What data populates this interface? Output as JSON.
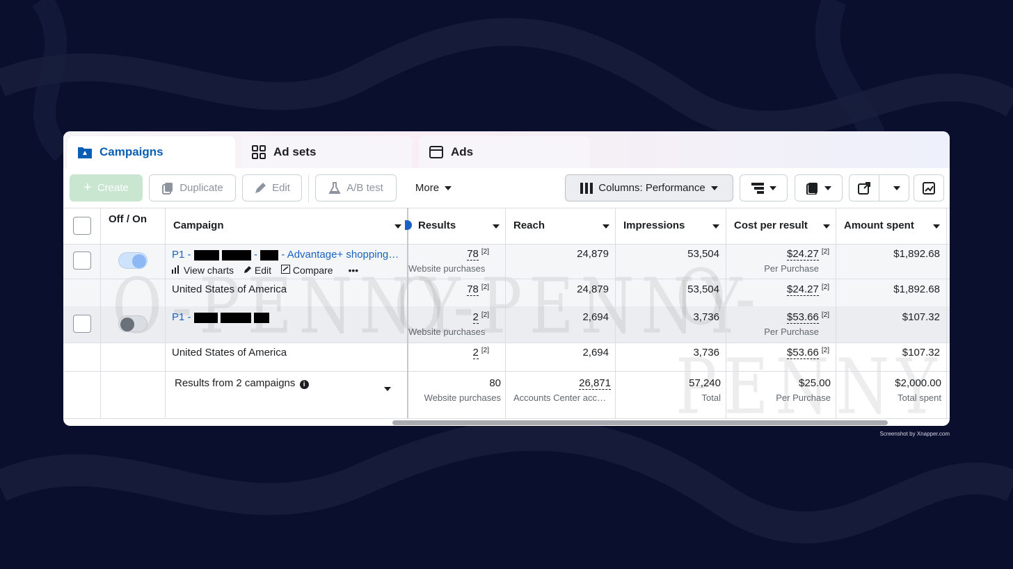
{
  "tabs": [
    {
      "label": "Campaigns"
    },
    {
      "label": "Ad sets"
    },
    {
      "label": "Ads"
    }
  ],
  "toolbar": {
    "create": "Create",
    "duplicate": "Duplicate",
    "edit": "Edit",
    "ab_test": "A/B test",
    "more": "More",
    "columns": "Columns: Performance"
  },
  "headers": {
    "offon": "Off / On",
    "campaign": "Campaign",
    "results": "Results",
    "reach": "Reach",
    "impressions": "Impressions",
    "cost": "Cost per result",
    "amount": "Amount spent"
  },
  "rows": [
    {
      "name_prefix": "P1 -",
      "name_suffix": "- Advantage+ shopping…",
      "actions": {
        "view_charts": "View charts",
        "edit": "Edit",
        "compare": "Compare",
        "more": "•••"
      },
      "results": "78",
      "results_sup": "[2]",
      "results_sub": "Website purchases",
      "reach": "24,879",
      "impressions": "53,504",
      "cost": "$24.27",
      "cost_sup": "[2]",
      "cost_sub": "Per Purchase",
      "amount": "$1,892.68",
      "breakdown": {
        "label": "United States of America",
        "results": "78",
        "results_sup": "[2]",
        "reach": "24,879",
        "impressions": "53,504",
        "cost": "$24.27",
        "cost_sup": "[2]",
        "amount": "$1,892.68"
      }
    },
    {
      "name_prefix": "P1 -",
      "results": "2",
      "results_sup": "[2]",
      "results_sub": "Website purchases",
      "reach": "2,694",
      "impressions": "3,736",
      "cost": "$53.66",
      "cost_sup": "[2]",
      "cost_sub": "Per Purchase",
      "amount": "$107.32",
      "breakdown": {
        "label": "United States of America",
        "results": "2",
        "results_sup": "[2]",
        "reach": "2,694",
        "impressions": "3,736",
        "cost": "$53.66",
        "cost_sup": "[2]",
        "amount": "$107.32"
      }
    }
  ],
  "totals": {
    "label": "Results from 2 campaigns",
    "results": "80",
    "results_sub": "Website purchases",
    "reach": "26,871",
    "reach_sub": "Accounts Center acc…",
    "impressions": "57,240",
    "impressions_sub": "Total",
    "cost": "$25.00",
    "cost_sub": "Per Purchase",
    "amount": "$2,000.00",
    "amount_sub": "Total spent"
  },
  "watermark": "O-PENNY",
  "footer": "Screenshot by Xnapper.com",
  "colors": {
    "accent": "#0a5fb4",
    "link": "#1a62c4",
    "background": "#0b0f2e"
  }
}
